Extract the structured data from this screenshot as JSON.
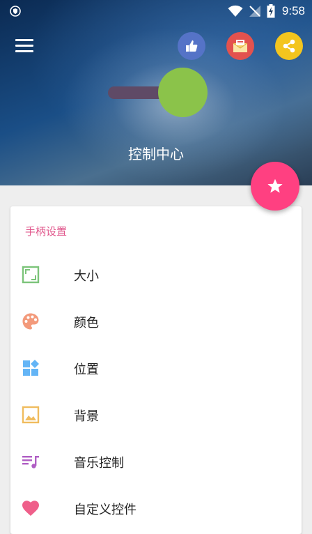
{
  "status_bar": {
    "time": "9:58"
  },
  "header": {
    "title": "控制中心"
  },
  "card": {
    "section_title": "手柄设置",
    "items": [
      {
        "label": "大小",
        "icon": "resize-icon"
      },
      {
        "label": "颜色",
        "icon": "palette-icon"
      },
      {
        "label": "位置",
        "icon": "position-icon"
      },
      {
        "label": "背景",
        "icon": "image-icon"
      },
      {
        "label": "音乐控制",
        "icon": "music-icon"
      },
      {
        "label": "自定义控件",
        "icon": "heart-icon"
      }
    ]
  },
  "colors": {
    "accent": "#ff4081",
    "like": "#5573c7",
    "mail": "#e3524e",
    "share": "#f3c51e",
    "knob": "#8bc34a",
    "section_title": "#e0548a"
  }
}
